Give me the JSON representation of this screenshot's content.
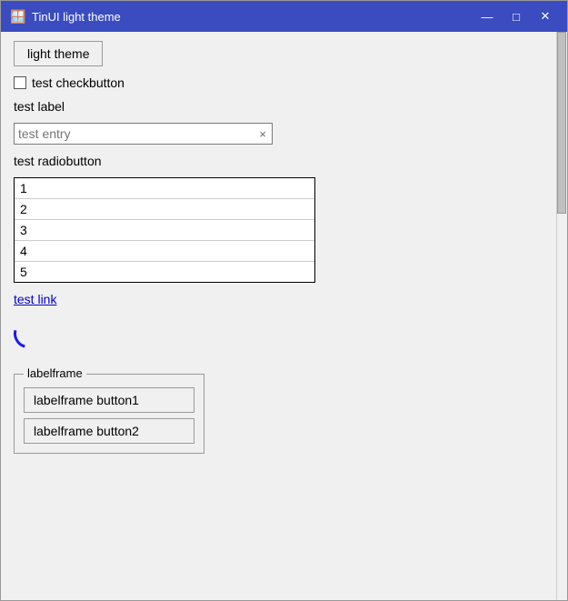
{
  "window": {
    "title": "TinUI light theme",
    "icon": "🪟"
  },
  "titlebar": {
    "minimize_label": "—",
    "maximize_label": "□",
    "close_label": "✕"
  },
  "main": {
    "button_label": "light theme",
    "checkbutton_label": "test checkbutton",
    "label_text": "test label",
    "entry_placeholder": "test entry",
    "entry_clear": "×",
    "radiobutton_label": "test radiobutton",
    "listbox_items": [
      "1",
      "2",
      "3",
      "4",
      "5"
    ],
    "link_text": "test link",
    "labelframe_title": "labelframe",
    "labelframe_btn1": "labelframe button1",
    "labelframe_btn2": "labelframe button2"
  }
}
